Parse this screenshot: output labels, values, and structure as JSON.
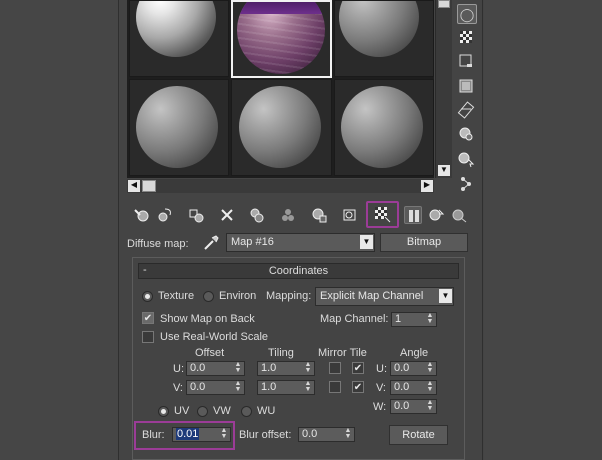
{
  "toolbar_right": {
    "icons": [
      "sample-type-icon",
      "background-icon",
      "sample-uv-tiling-icon",
      "video-color-check-icon",
      "make-preview-icon",
      "options-icon",
      "select-by-material-icon",
      "material-map-navigator-icon"
    ]
  },
  "toolbar_bottom": {
    "icons": [
      "get-material-icon",
      "put-to-scene-icon",
      "assign-material-icon",
      "reset-map-icon",
      "make-unique-icon",
      "put-to-library-icon",
      "material-id-channel-icon",
      "show-shaded-material-icon",
      "show-map-in-viewport-icon",
      "show-end-result-icon",
      "go-to-parent-icon",
      "go-forward-to-sibling-icon"
    ]
  },
  "map_row": {
    "label": "Diffuse map:",
    "map_name": "Map #16",
    "map_type": "Bitmap"
  },
  "coordinates": {
    "collapse": "-",
    "title": "Coordinates",
    "texture_label": "Texture",
    "environ_label": "Environ",
    "mapping_label": "Mapping:",
    "mapping_value": "Explicit Map Channel",
    "show_map_on_back": "Show Map on Back",
    "use_real_world_scale": "Use Real-World Scale",
    "map_channel_label": "Map Channel:",
    "map_channel_value": "1",
    "headers": {
      "offset": "Offset",
      "tiling": "Tiling",
      "mirror_tile": "Mirror Tile",
      "angle": "Angle"
    },
    "u_label": "U:",
    "v_label": "V:",
    "w_label": "W:",
    "u_offset": "0.0",
    "v_offset": "0.0",
    "u_tiling": "1.0",
    "v_tiling": "1.0",
    "u_angle": "0.0",
    "v_angle": "0.0",
    "w_angle": "0.0",
    "uv_label": "UV",
    "vw_label": "VW",
    "wu_label": "WU",
    "blur_label": "Blur:",
    "blur_value": "0.01",
    "blur_offset_label": "Blur offset:",
    "blur_offset_value": "0.0",
    "rotate_label": "Rotate"
  },
  "colors": {
    "highlight": "#9b3c97",
    "panel_bg": "#444444"
  }
}
